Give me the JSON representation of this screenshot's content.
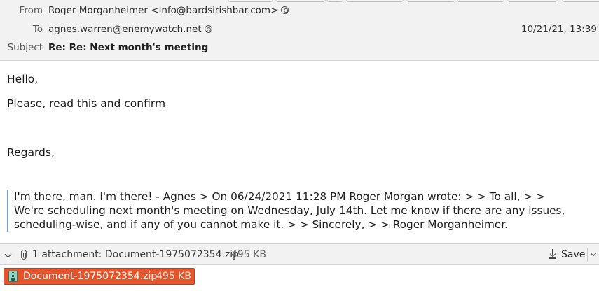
{
  "header": {
    "from_label": "From",
    "from_value": "Roger Morganheimer <info@bardsirishbar.com>",
    "to_label": "To",
    "to_value": "agnes.warren@enemywatch.net",
    "subject_label": "Subject",
    "subject_value": "Re: Re: Next month's meeting",
    "date": "10/21/21, 13:39",
    "address_icon": "contact-icon"
  },
  "body": {
    "greeting": "Hello,",
    "line1": "Please, read this and confirm",
    "closing": "Regards,",
    "quote_line1": "I'm there, man. I'm there! - Agnes > On 06/24/2021 11:28 PM Roger Morgan wrote: > > To all, > >",
    "quote_line2": "We're scheduling next month's meeting on Wednesday, July 14th. Let me know if there are any issues,",
    "quote_line3": "scheduling-wise, and if any of you cannot make it. > > Sincerely, > > Roger Morganheimer."
  },
  "attachments": {
    "summary": "1 attachment: Document-1975072354.zip",
    "size": "495 KB",
    "save_label": "Save",
    "items": [
      {
        "name": "Document-1975072354.zip",
        "size": "495 KB",
        "icon": "zip-file-icon"
      }
    ]
  },
  "colors": {
    "chip_background": "#e4552b",
    "quote_bar": "#7c9bd1",
    "header_background": "#f2f2f2"
  }
}
